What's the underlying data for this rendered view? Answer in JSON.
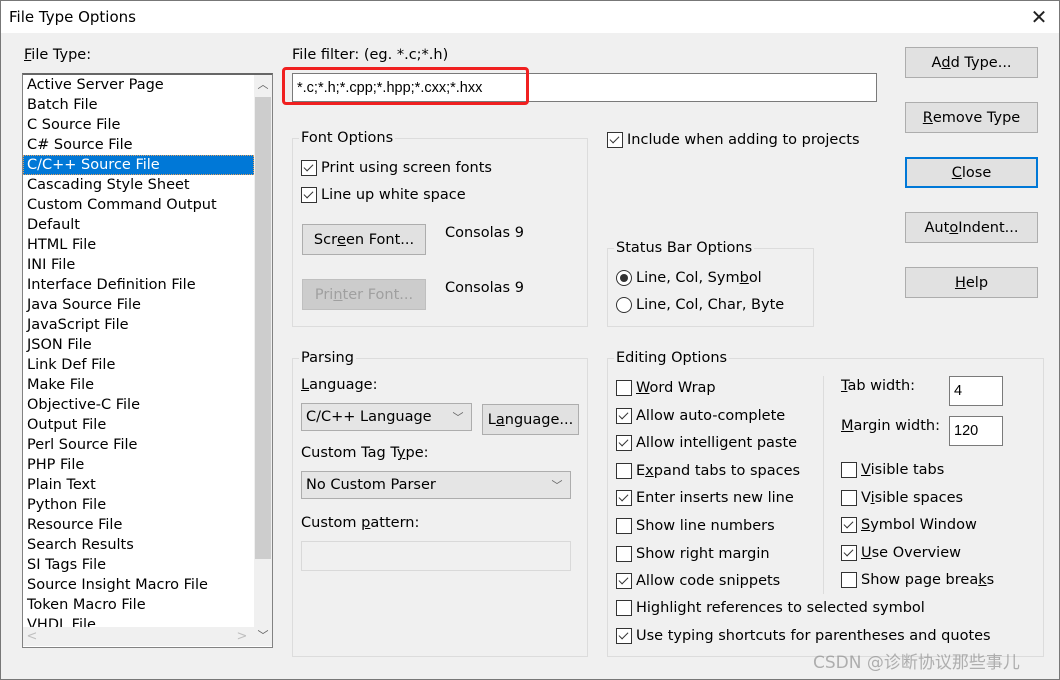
{
  "window": {
    "title": "File Type Options",
    "close_icon": "close-icon"
  },
  "file_type": {
    "label_prefix": "",
    "label_mnemonic": "F",
    "label_rest": "ile Type:",
    "items": [
      "Active Server Page",
      "Batch File",
      "C Source File",
      "C# Source File",
      "C/C++ Source File",
      "Cascading Style Sheet",
      "Custom Command Output",
      "Default",
      "HTML File",
      "INI File",
      "Interface Definition File",
      "Java Source File",
      "JavaScript File",
      "JSON File",
      "Link Def File",
      "Make File",
      "Objective-C File",
      "Output File",
      "Perl Source File",
      "PHP File",
      "Plain Text",
      "Python File",
      "Resource File",
      "Search Results",
      "SI Tags File",
      "Source Insight Macro File",
      "Token Macro File",
      "VHDL File"
    ],
    "selected_index": 4
  },
  "file_filter": {
    "label": "File filter: (eg. *.c;*.h)",
    "value": "*.c;*.h;*.cpp;*.hpp;*.cxx;*.hxx",
    "highlight_color": "#f02020"
  },
  "include_when_adding": {
    "label": "Include when adding to projects",
    "checked": true
  },
  "font_options": {
    "title": "Font Options",
    "print_screen_fonts": {
      "label": "Print using screen fonts",
      "checked": true
    },
    "line_up_white_space": {
      "label": "Line up white space",
      "checked": true
    },
    "screen_font_btn": {
      "pre": "Scr",
      "mn": "e",
      "post": "en Font..."
    },
    "screen_font_value": "Consolas 9",
    "printer_font_btn": {
      "pre": "Pri",
      "mn": "n",
      "post": "ter Font..."
    },
    "printer_font_value": "Consolas 9"
  },
  "status_bar_options": {
    "title": "Status Bar Options",
    "options": [
      {
        "pre": "Line, Col, Sym",
        "mn": "b",
        "post": "ol",
        "checked": true
      },
      {
        "pre": "Line, Col, Char, Byte",
        "mn": "",
        "post": "",
        "checked": false
      }
    ]
  },
  "buttons": {
    "add_type": {
      "pre": "A",
      "mn": "d",
      "post": "d Type..."
    },
    "remove_type": {
      "pre": "",
      "mn": "R",
      "post": "emove Type"
    },
    "close": {
      "pre": "",
      "mn": "C",
      "post": "lose"
    },
    "auto_indent": {
      "pre": "Aut",
      "mn": "o",
      "post": " Indent..."
    },
    "help": {
      "pre": "",
      "mn": "H",
      "post": "elp"
    }
  },
  "parsing": {
    "title": "Parsing",
    "language_label": {
      "pre": "",
      "mn": "L",
      "post": "anguage:"
    },
    "language_value": "C/C++ Language",
    "language_btn": {
      "pre": "L",
      "mn": "a",
      "post": "nguage..."
    },
    "custom_tag_label": {
      "pre": "Custom Tag T",
      "mn": "y",
      "post": "pe:"
    },
    "custom_tag_value": "No Custom Parser",
    "custom_pattern_label": {
      "pre": "Custom ",
      "mn": "p",
      "post": "attern:"
    },
    "custom_pattern_value": ""
  },
  "editing_options": {
    "title": "Editing Options",
    "left": [
      {
        "pre": "",
        "mn": "W",
        "post": "ord Wrap",
        "checked": false
      },
      {
        "pre": "Allow auto-complete",
        "mn": "",
        "post": "",
        "checked": true
      },
      {
        "pre": "Allow intelligent paste",
        "mn": "",
        "post": "",
        "checked": true
      },
      {
        "pre": "E",
        "mn": "x",
        "post": "pand tabs to spaces",
        "checked": false
      },
      {
        "pre": "Enter inserts new line",
        "mn": "",
        "post": "",
        "checked": true
      },
      {
        "pre": "Show line numbers",
        "mn": "",
        "post": "",
        "checked": false
      },
      {
        "pre": "Show right margin",
        "mn": "",
        "post": "",
        "checked": false
      },
      {
        "pre": "Allow code snippets",
        "mn": "",
        "post": "",
        "checked": true
      }
    ],
    "tab_width": {
      "pre": "",
      "mn": "T",
      "post": "ab width:",
      "value": "4"
    },
    "margin_width": {
      "pre": "",
      "mn": "M",
      "post": "argin width:",
      "value": "120"
    },
    "right": [
      {
        "pre": "",
        "mn": "V",
        "post": "isible tabs",
        "checked": false
      },
      {
        "pre": "V",
        "mn": "i",
        "post": "sible spaces",
        "checked": false
      },
      {
        "pre": "",
        "mn": "S",
        "post": "ymbol Window",
        "checked": true
      },
      {
        "pre": "",
        "mn": "U",
        "post": "se Overview",
        "checked": true
      },
      {
        "pre": "Show page brea",
        "mn": "k",
        "post": "s",
        "checked": false
      }
    ],
    "bottom": [
      {
        "pre": "Highlight references to selected symbol",
        "mn": "",
        "post": "",
        "checked": false
      },
      {
        "pre": "Use typing shortcuts for parentheses and quotes",
        "mn": "",
        "post": "",
        "checked": true
      }
    ]
  },
  "watermark": "CSDN @诊断协议那些事儿"
}
